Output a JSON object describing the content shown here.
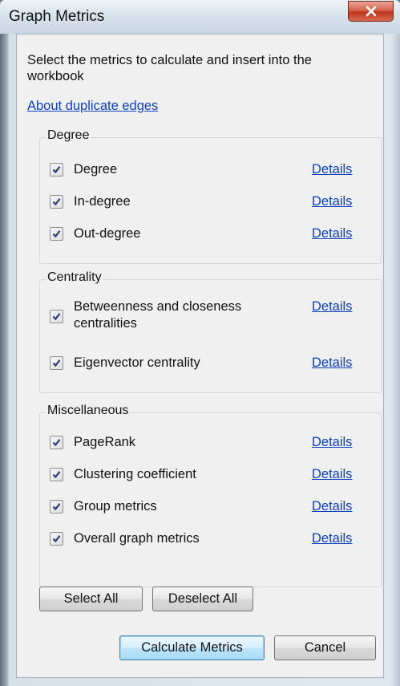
{
  "window": {
    "title": "Graph Metrics",
    "close_symbol": "close-icon"
  },
  "instruction": "Select the metrics to calculate and insert into the workbook",
  "about_link": "About duplicate edges",
  "groups": [
    {
      "label": "Degree",
      "items": [
        {
          "label": "Degree",
          "checked": true,
          "details": "Details"
        },
        {
          "label": "In-degree",
          "checked": true,
          "details": "Details"
        },
        {
          "label": "Out-degree",
          "checked": true,
          "details": "Details"
        }
      ]
    },
    {
      "label": "Centrality",
      "items": [
        {
          "label": "Betweenness and closeness centralities",
          "checked": true,
          "details": "Details"
        },
        {
          "label": "Eigenvector centrality",
          "checked": true,
          "details": "Details"
        }
      ]
    },
    {
      "label": "Miscellaneous",
      "items": [
        {
          "label": "PageRank",
          "checked": true,
          "details": "Details"
        },
        {
          "label": "Clustering coefficient",
          "checked": true,
          "details": "Details"
        },
        {
          "label": "Group metrics",
          "checked": true,
          "details": "Details"
        },
        {
          "label": "Overall graph metrics",
          "checked": true,
          "details": "Details"
        }
      ]
    }
  ],
  "buttons": {
    "select_all": "Select All",
    "deselect_all": "Deselect All",
    "calculate": "Calculate Metrics",
    "cancel": "Cancel"
  },
  "colors": {
    "link": "#0b3fb8",
    "close_button": "#c2351d",
    "primary_button_border": "#3c7fb1"
  }
}
